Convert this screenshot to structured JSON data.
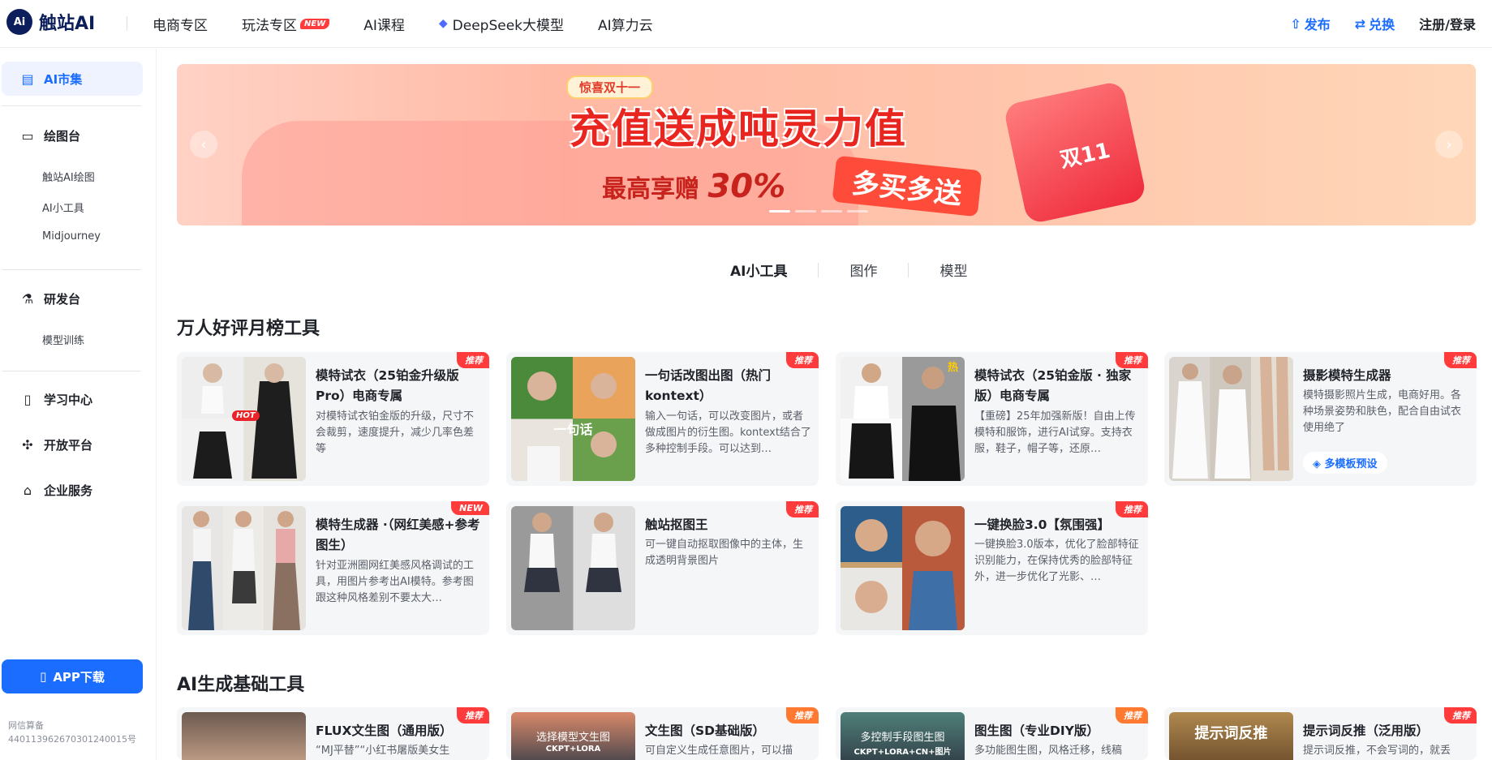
{
  "header": {
    "logo_mark": "Ai",
    "logo_text": "触站AI",
    "nav": [
      {
        "label": "电商专区"
      },
      {
        "label": "玩法专区",
        "badge": "NEW"
      },
      {
        "label": "AI课程"
      },
      {
        "label": "DeepSeek大模型"
      },
      {
        "label": "AI算力云"
      }
    ],
    "publish": "发布",
    "redeem": "兑换",
    "login": "注册/登录"
  },
  "sidebar": {
    "market": "AI市集",
    "draw": "绘图台",
    "draw_items": [
      "触站AI绘图",
      "AI小工具",
      "Midjourney"
    ],
    "dev": "研发台",
    "dev_items": [
      "模型训练"
    ],
    "learn": "学习中心",
    "open": "开放平台",
    "enterprise": "企业服务",
    "app_download": "APP下载",
    "record_label": "网信算备",
    "record_number": "440113962670301240015号"
  },
  "banner": {
    "tag": "惊喜双十一",
    "title": "充值送成吨灵力值",
    "sub_prefix": "最高享赠",
    "sub_pct": "30%",
    "pill": "多买多送",
    "gift_text": "双11"
  },
  "tabs": [
    "AI小工具",
    "图作",
    "模型"
  ],
  "sections": {
    "top_title": "万人好评月榜工具",
    "basic_title": "AI生成基础工具"
  },
  "top_tools": [
    {
      "title": "模特试衣（25铂金升级版Pro）电商专属",
      "desc": "对模特试衣铂金版的升级，尺寸不会裁剪，速度提升，减少几率色差等",
      "badge": "推荐",
      "thumb_label": "HOT"
    },
    {
      "title": "一句话改图出图（热门kontext）",
      "desc": "输入一句话，可以改变图片，或者做成图片的衍生图。kontext结合了多种控制手段。可以达到…",
      "badge": "推荐",
      "thumb_label": "一句话"
    },
    {
      "title": "模特试衣（25铂金版 · 独家版）电商专属",
      "desc": "【重磅】25年加强新版！自由上传模特和服饰，进行AI试穿。支持衣服，鞋子，帽子等，还原…",
      "badge": "推荐",
      "thumb_label": "热"
    },
    {
      "title": "摄影模特生成器",
      "desc": "模特摄影照片生成，电商好用。各种场景姿势和肤色，配合自由试衣使用绝了",
      "badge": "推荐",
      "button": "多模板预设"
    },
    {
      "title": "模特生成器 ·（网红美感+参考图生）",
      "desc": "针对亚洲圈网红美感风格调试的工具，用图片参考出AI模特。参考图跟这种风格差别不要太大…",
      "badge": "NEW"
    },
    {
      "title": "触站抠图王",
      "desc": "可一键自动抠取图像中的主体，生成透明背景图片",
      "badge": "推荐"
    },
    {
      "title": "一键换脸3.0【氛围强】",
      "desc": "一键换脸3.0版本，优化了脸部特征识别能力，在保持优秀的脸部特征外，进一步优化了光影、…",
      "badge": "推荐"
    }
  ],
  "basic_tools": [
    {
      "title": "FLUX文生图（通用版）",
      "desc": "“MJ平替”“小红书屠版美女生",
      "badge": "推荐"
    },
    {
      "title": "文生图（SD基础版）",
      "desc": "可自定义生成任意图片，可以描",
      "badge": "推荐",
      "overlay": "选择模型文生图",
      "overlay_sub": "CKPT+LORA"
    },
    {
      "title": "图生图（专业DIY版）",
      "desc": "多功能图生图，风格迁移，线稿",
      "badge": "推荐",
      "overlay": "多控制手段图生图",
      "overlay_sub": "CKPT+LORA+CN+图片"
    },
    {
      "title": "提示词反推（泛用版）",
      "desc": "提示词反推，不会写词的，就丢",
      "badge": "推荐",
      "overlay": "提示词反推"
    }
  ],
  "colors": {
    "accent": "#1a6dff",
    "badge_red": "#ff3b3b",
    "badge_orange": "#ff7a30"
  }
}
